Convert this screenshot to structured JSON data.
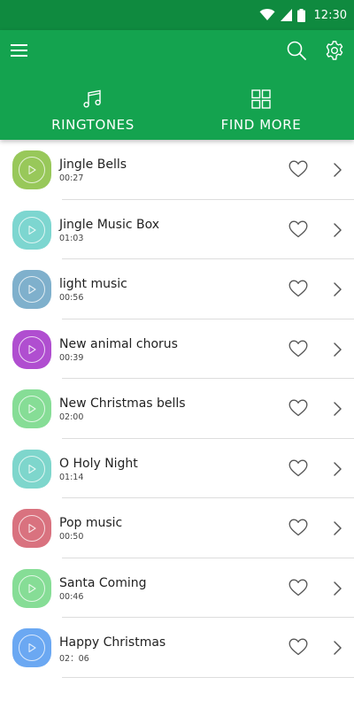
{
  "status_bar": {
    "time": "12:30",
    "icons": [
      "wifi-icon",
      "signal-icon",
      "battery-icon"
    ]
  },
  "colors": {
    "status_bar": "#0f8a3f",
    "app_bar": "#14a34f",
    "divider": "#dddddd"
  },
  "header": {
    "icons": [
      "menu-icon",
      "search-icon",
      "settings-gear-icon"
    ],
    "tabs": [
      {
        "label": "RINGTONES",
        "icon": "music-note-icon"
      },
      {
        "label": "FIND MORE",
        "icon": "grid-icon"
      }
    ]
  },
  "ringtones": [
    {
      "title": "Jingle Bells",
      "duration": "00:27",
      "color": "#98c85a"
    },
    {
      "title": "Jingle Music Box",
      "duration": "01:03",
      "color": "#7dd6d0"
    },
    {
      "title": "light music",
      "duration": "00:56",
      "color": "#7fb0cc"
    },
    {
      "title": "New animal chorus",
      "duration": "00:39",
      "color": "#b04ed0"
    },
    {
      "title": "New Christmas bells",
      "duration": "02:00",
      "color": "#86dd96"
    },
    {
      "title": "O Holy Night",
      "duration": "01:14",
      "color": "#7ed6cc"
    },
    {
      "title": "Pop music",
      "duration": "00:50",
      "color": "#d9727f"
    },
    {
      "title": "Santa Coming",
      "duration": "00:46",
      "color": "#86dd96"
    },
    {
      "title": "Happy Christmas",
      "duration": "02：06",
      "color": "#6ba8f2"
    }
  ]
}
